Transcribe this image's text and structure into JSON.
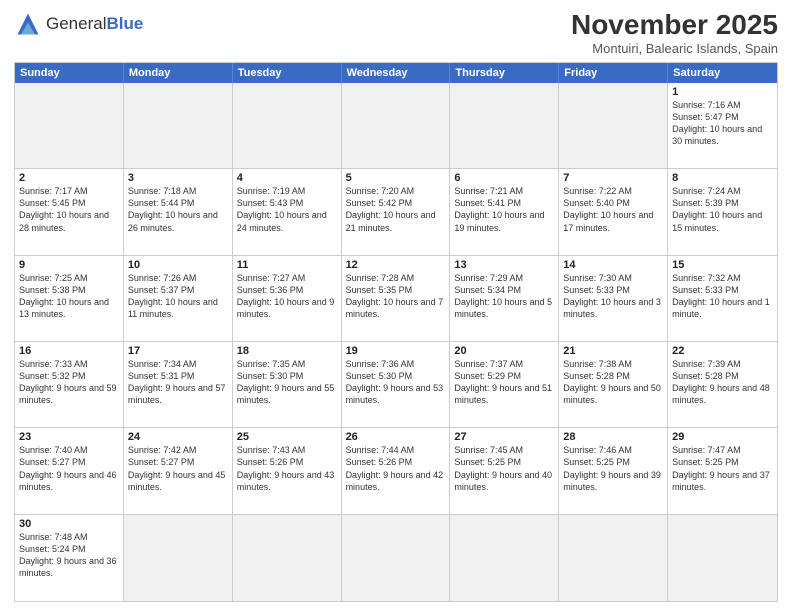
{
  "header": {
    "logo_general": "General",
    "logo_blue": "Blue",
    "month_title": "November 2025",
    "subtitle": "Montuiri, Balearic Islands, Spain"
  },
  "day_headers": [
    "Sunday",
    "Monday",
    "Tuesday",
    "Wednesday",
    "Thursday",
    "Friday",
    "Saturday"
  ],
  "cells": [
    {
      "date": "",
      "info": "",
      "empty": true
    },
    {
      "date": "",
      "info": "",
      "empty": true
    },
    {
      "date": "",
      "info": "",
      "empty": true
    },
    {
      "date": "",
      "info": "",
      "empty": true
    },
    {
      "date": "",
      "info": "",
      "empty": true
    },
    {
      "date": "",
      "info": "",
      "empty": true
    },
    {
      "date": "1",
      "info": "Sunrise: 7:16 AM\nSunset: 5:47 PM\nDaylight: 10 hours and 30 minutes.",
      "empty": false
    },
    {
      "date": "2",
      "info": "Sunrise: 7:17 AM\nSunset: 5:45 PM\nDaylight: 10 hours and 28 minutes.",
      "empty": false
    },
    {
      "date": "3",
      "info": "Sunrise: 7:18 AM\nSunset: 5:44 PM\nDaylight: 10 hours and 26 minutes.",
      "empty": false
    },
    {
      "date": "4",
      "info": "Sunrise: 7:19 AM\nSunset: 5:43 PM\nDaylight: 10 hours and 24 minutes.",
      "empty": false
    },
    {
      "date": "5",
      "info": "Sunrise: 7:20 AM\nSunset: 5:42 PM\nDaylight: 10 hours and 21 minutes.",
      "empty": false
    },
    {
      "date": "6",
      "info": "Sunrise: 7:21 AM\nSunset: 5:41 PM\nDaylight: 10 hours and 19 minutes.",
      "empty": false
    },
    {
      "date": "7",
      "info": "Sunrise: 7:22 AM\nSunset: 5:40 PM\nDaylight: 10 hours and 17 minutes.",
      "empty": false
    },
    {
      "date": "8",
      "info": "Sunrise: 7:24 AM\nSunset: 5:39 PM\nDaylight: 10 hours and 15 minutes.",
      "empty": false
    },
    {
      "date": "9",
      "info": "Sunrise: 7:25 AM\nSunset: 5:38 PM\nDaylight: 10 hours and 13 minutes.",
      "empty": false
    },
    {
      "date": "10",
      "info": "Sunrise: 7:26 AM\nSunset: 5:37 PM\nDaylight: 10 hours and 11 minutes.",
      "empty": false
    },
    {
      "date": "11",
      "info": "Sunrise: 7:27 AM\nSunset: 5:36 PM\nDaylight: 10 hours and 9 minutes.",
      "empty": false
    },
    {
      "date": "12",
      "info": "Sunrise: 7:28 AM\nSunset: 5:35 PM\nDaylight: 10 hours and 7 minutes.",
      "empty": false
    },
    {
      "date": "13",
      "info": "Sunrise: 7:29 AM\nSunset: 5:34 PM\nDaylight: 10 hours and 5 minutes.",
      "empty": false
    },
    {
      "date": "14",
      "info": "Sunrise: 7:30 AM\nSunset: 5:33 PM\nDaylight: 10 hours and 3 minutes.",
      "empty": false
    },
    {
      "date": "15",
      "info": "Sunrise: 7:32 AM\nSunset: 5:33 PM\nDaylight: 10 hours and 1 minute.",
      "empty": false
    },
    {
      "date": "16",
      "info": "Sunrise: 7:33 AM\nSunset: 5:32 PM\nDaylight: 9 hours and 59 minutes.",
      "empty": false
    },
    {
      "date": "17",
      "info": "Sunrise: 7:34 AM\nSunset: 5:31 PM\nDaylight: 9 hours and 57 minutes.",
      "empty": false
    },
    {
      "date": "18",
      "info": "Sunrise: 7:35 AM\nSunset: 5:30 PM\nDaylight: 9 hours and 55 minutes.",
      "empty": false
    },
    {
      "date": "19",
      "info": "Sunrise: 7:36 AM\nSunset: 5:30 PM\nDaylight: 9 hours and 53 minutes.",
      "empty": false
    },
    {
      "date": "20",
      "info": "Sunrise: 7:37 AM\nSunset: 5:29 PM\nDaylight: 9 hours and 51 minutes.",
      "empty": false
    },
    {
      "date": "21",
      "info": "Sunrise: 7:38 AM\nSunset: 5:28 PM\nDaylight: 9 hours and 50 minutes.",
      "empty": false
    },
    {
      "date": "22",
      "info": "Sunrise: 7:39 AM\nSunset: 5:28 PM\nDaylight: 9 hours and 48 minutes.",
      "empty": false
    },
    {
      "date": "23",
      "info": "Sunrise: 7:40 AM\nSunset: 5:27 PM\nDaylight: 9 hours and 46 minutes.",
      "empty": false
    },
    {
      "date": "24",
      "info": "Sunrise: 7:42 AM\nSunset: 5:27 PM\nDaylight: 9 hours and 45 minutes.",
      "empty": false
    },
    {
      "date": "25",
      "info": "Sunrise: 7:43 AM\nSunset: 5:26 PM\nDaylight: 9 hours and 43 minutes.",
      "empty": false
    },
    {
      "date": "26",
      "info": "Sunrise: 7:44 AM\nSunset: 5:26 PM\nDaylight: 9 hours and 42 minutes.",
      "empty": false
    },
    {
      "date": "27",
      "info": "Sunrise: 7:45 AM\nSunset: 5:25 PM\nDaylight: 9 hours and 40 minutes.",
      "empty": false
    },
    {
      "date": "28",
      "info": "Sunrise: 7:46 AM\nSunset: 5:25 PM\nDaylight: 9 hours and 39 minutes.",
      "empty": false
    },
    {
      "date": "29",
      "info": "Sunrise: 7:47 AM\nSunset: 5:25 PM\nDaylight: 9 hours and 37 minutes.",
      "empty": false
    },
    {
      "date": "30",
      "info": "Sunrise: 7:48 AM\nSunset: 5:24 PM\nDaylight: 9 hours and 36 minutes.",
      "empty": false
    },
    {
      "date": "",
      "info": "",
      "empty": true
    },
    {
      "date": "",
      "info": "",
      "empty": true
    },
    {
      "date": "",
      "info": "",
      "empty": true
    },
    {
      "date": "",
      "info": "",
      "empty": true
    },
    {
      "date": "",
      "info": "",
      "empty": true
    },
    {
      "date": "",
      "info": "",
      "empty": true
    }
  ]
}
